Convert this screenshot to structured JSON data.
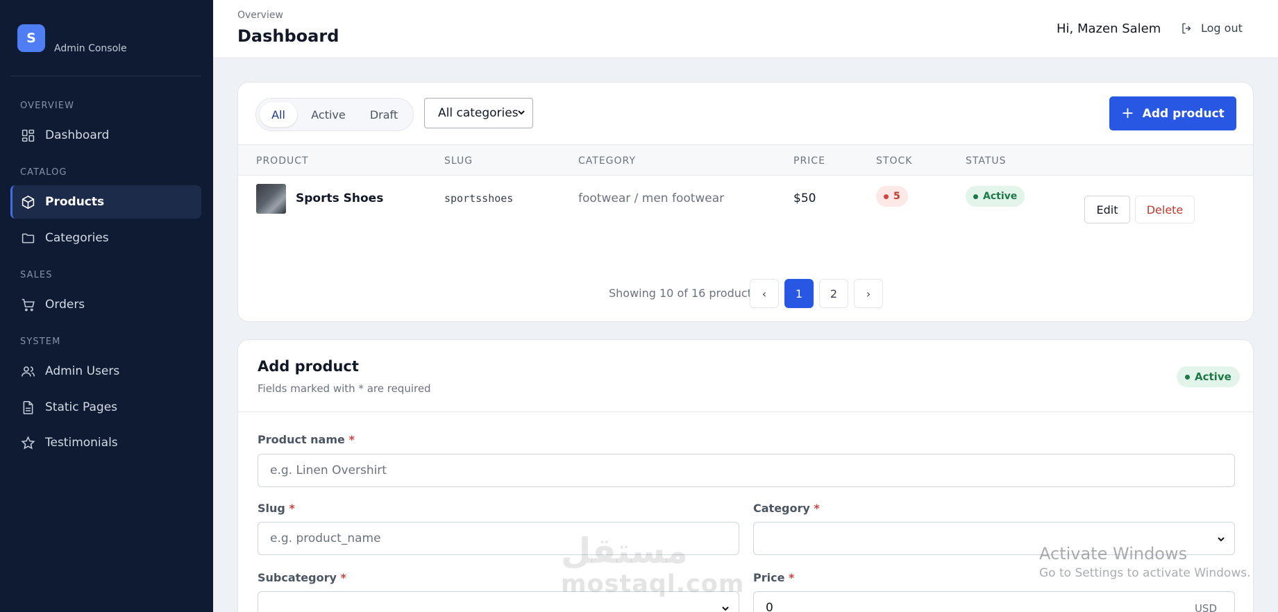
{
  "sidebar": {
    "logo_letter": "S",
    "brand_name": "Admin Console",
    "sections": {
      "overview": "OVERVIEW",
      "catalog": "CATALOG",
      "sales": "SALES",
      "system": "SYSTEM"
    },
    "items": {
      "dashboard": {
        "label": "Dashboard",
        "icon": "grid-icon"
      },
      "products": {
        "label": "Products",
        "icon": "box-icon",
        "active": true
      },
      "categories": {
        "label": "Categories",
        "icon": "folder-icon"
      },
      "orders": {
        "label": "Orders",
        "icon": "cart-icon"
      },
      "admin_users": {
        "label": "Admin Users",
        "icon": "users-icon"
      },
      "static_pages": {
        "label": "Static Pages",
        "icon": "file-icon"
      },
      "testimonials": {
        "label": "Testimonials",
        "icon": "star-icon"
      }
    }
  },
  "header": {
    "breadcrumb": "Overview",
    "title": "Dashboard",
    "greeting": "Hi, Mazen Salem",
    "logout_label": "Log out"
  },
  "products": {
    "filters": {
      "all": "All",
      "active": "Active",
      "draft": "Draft",
      "selected": "All"
    },
    "category_select": "All categories",
    "add_button": "Add product",
    "columns": {
      "product": "PRODUCT",
      "slug": "SLUG",
      "category": "CATEGORY",
      "price": "PRICE",
      "stock": "STOCK",
      "status": "STATUS"
    },
    "rows": [
      {
        "name": "Sports Shoes",
        "slug": "sportsshoes",
        "category": "footwear / men footwear",
        "price": "$50",
        "stock": "5",
        "status": "Active",
        "edit": "Edit",
        "delete": "Delete"
      }
    ],
    "pagination": {
      "summary": "Showing 10 of 16 products",
      "prev": "‹",
      "pages": [
        "1",
        "2"
      ],
      "current": "1",
      "next": "›"
    }
  },
  "form": {
    "title": "Add product",
    "subtitle": "Fields marked with * are required",
    "status_badge": "Active",
    "product_name": {
      "label": "Product name",
      "placeholder": "e.g. Linen Overshirt"
    },
    "slug": {
      "label": "Slug",
      "placeholder": "e.g. product_name"
    },
    "category": {
      "label": "Category",
      "value": ""
    },
    "subcategory": {
      "label": "Subcategory",
      "value": ""
    },
    "price": {
      "label": "Price",
      "value": "0",
      "suffix": "USD"
    },
    "required_mark": "*"
  },
  "watermarks": {
    "site_logo": "مستقل",
    "site_name": "mostaql.com",
    "windows_title": "Activate Windows",
    "windows_sub": "Go to Settings to activate Windows."
  },
  "colors": {
    "sidebar_bg": "#0f1b33",
    "accent": "#2858e3",
    "danger": "#c0392b",
    "success": "#1d7a47"
  }
}
